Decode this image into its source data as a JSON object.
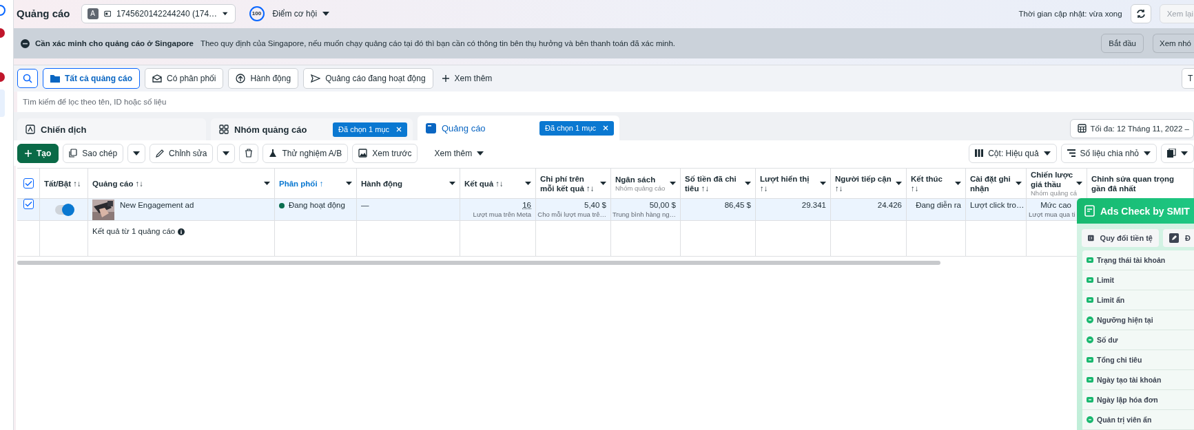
{
  "header": {
    "title": "Quảng cáo",
    "account": {
      "initial": "A",
      "name": "1745620142244240 (174…"
    },
    "score": "100",
    "score_label": "Điểm cơ hội",
    "updated": "Thời gian cập nhật: vừa xong",
    "review_button": {
      "label": "Xem lại",
      "disabled": true
    }
  },
  "banner": {
    "title": "Cần xác minh cho quảng cáo ở Singapore",
    "message": "Theo quy định của Singapore, nếu muốn chạy quảng cáo tại đó thì bạn cần có thông tin bên thụ hưởng và bên thanh toán đã xác minh.",
    "buttons": [
      "Bắt đầu",
      "Xem nhó"
    ]
  },
  "filters": {
    "items": [
      {
        "label": "Tất cả quảng cáo",
        "selected": true
      },
      {
        "label": "Có phân phối",
        "selected": false
      },
      {
        "label": "Hành động",
        "selected": false
      },
      {
        "label": "Quảng cáo đang hoạt động",
        "selected": false
      }
    ],
    "more": "Xem thêm",
    "right_button": "T"
  },
  "search": {
    "placeholder": "Tìm kiếm để lọc theo tên, ID hoặc số liệu"
  },
  "tabs": [
    {
      "label": "Chiến dịch",
      "selected": false
    },
    {
      "label": "Nhóm quảng cáo",
      "selected": false,
      "chip": "Đã chọn 1 mục"
    },
    {
      "label": "Quảng cáo",
      "selected": true,
      "chip": "Đã chọn 1 mục"
    }
  ],
  "date_range": "Tối đa: 12 Tháng 11, 2022 –",
  "toolbar": {
    "left": [
      {
        "kind": "primary",
        "label": "Tạo"
      },
      {
        "kind": "split",
        "label": "Sao chép"
      },
      {
        "kind": "split",
        "label": "Chỉnh sửa"
      },
      {
        "kind": "icon"
      },
      {
        "kind": "button",
        "label": "Thử nghiệm A/B"
      },
      {
        "kind": "button",
        "label": "Xem trước"
      },
      {
        "kind": "menu",
        "label": "Xem thêm"
      }
    ],
    "right": [
      {
        "kind": "button",
        "label": "Cột: Hiệu quả"
      },
      {
        "kind": "button",
        "label": "Số liệu chia nhỏ"
      },
      {
        "kind": "icon"
      }
    ]
  },
  "table": {
    "all_checked": true,
    "columns": [
      {
        "label": "Tất/Bật ↑↓",
        "kind": "toggle",
        "sorted": false,
        "menu": false
      },
      {
        "label": "Quảng cáo ↑↓",
        "kind": "ad",
        "sorted": false,
        "menu": true
      },
      {
        "label": "Phân phối ↑",
        "kind": "status",
        "sorted": true,
        "menu": true
      },
      {
        "label": "Hành động",
        "kind": "text",
        "sorted": false,
        "menu": true
      },
      {
        "label": "Kết quả ↑↓",
        "kind": "number",
        "sorted": false,
        "menu": true
      },
      {
        "label": "Chi phí trên mỗi kết quả ↑↓",
        "kind": "number",
        "sorted": false,
        "menu": true
      },
      {
        "label": "Ngân sách",
        "sub": "Nhóm quảng cáo",
        "kind": "number",
        "sorted": false,
        "menu": true
      },
      {
        "label": "Số tiền đã chi tiêu ↑↓",
        "kind": "number",
        "sorted": false,
        "menu": true
      },
      {
        "label": "Lượt hiển thị ↑↓",
        "kind": "number",
        "sorted": false,
        "menu": true
      },
      {
        "label": "Người tiếp cận ↑↓",
        "kind": "number",
        "sorted": false,
        "menu": true
      },
      {
        "label": "Kết thúc ↑↓",
        "kind": "number",
        "sorted": false,
        "menu": true
      },
      {
        "label": "Cài đặt ghi nhận",
        "kind": "text",
        "sorted": false,
        "menu": true
      },
      {
        "label": "Chiến lược giá thầu",
        "sub": "Nhóm quảng cá",
        "kind": "number",
        "sorted": false,
        "menu": true
      },
      {
        "label": "Chỉnh sửa quan trọng gần đâ nhất",
        "kind": "text",
        "sorted": false,
        "menu": false
      }
    ],
    "rows": [
      {
        "checked": true,
        "cells": [
          {
            "on": true
          },
          {
            "text": "New Engagement ad"
          },
          {
            "text": "Đang hoạt động",
            "color": "#0a6e4f"
          },
          {
            "text": "—"
          },
          {
            "text": "16",
            "sub": "Lượt mua trên Meta"
          },
          {
            "text": "5,40 $",
            "sub": "Cho mỗi lượt mua trê…"
          },
          {
            "text": "50,00 $",
            "sub": "Trung bình hàng ng…"
          },
          {
            "text": "86,45 $"
          },
          {
            "text": "29.341"
          },
          {
            "text": "24.426"
          },
          {
            "text": "Đang diễn ra"
          },
          {
            "text": "Lượt click tro…"
          },
          {
            "text": "Mức cao",
            "sub": "Lượt mua qua ti"
          }
        ]
      }
    ],
    "summary": "Kết quả từ 1 quảng cáo"
  },
  "panel": {
    "title": "Ads Check by SMIT",
    "buttons": [
      "Quy đổi tiền tệ",
      "Đ"
    ],
    "items": [
      "Trạng thái tài khoản",
      "Limit",
      "Limit ẩn",
      "Ngưỡng hiện tại",
      "Số dư",
      "Tổng chi tiêu",
      "Ngày tạo tài khoản",
      "Ngày lập hóa đơn",
      "Quản trị viên ẩn"
    ]
  }
}
